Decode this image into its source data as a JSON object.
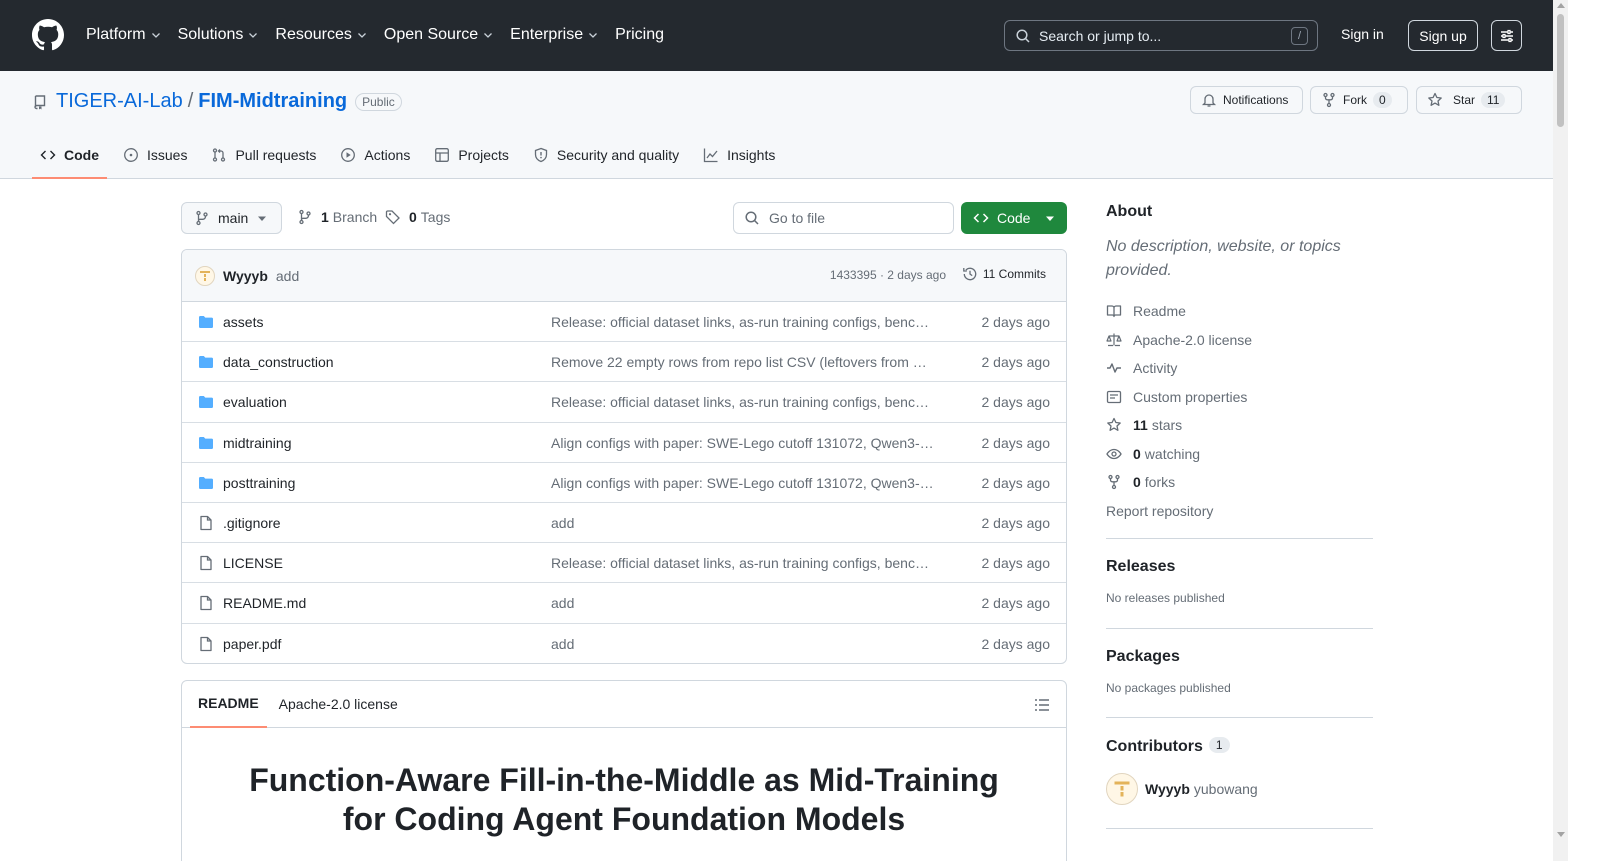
{
  "header": {
    "nav": [
      {
        "label": "Platform",
        "has_caret": true
      },
      {
        "label": "Solutions",
        "has_caret": true
      },
      {
        "label": "Resources",
        "has_caret": true
      },
      {
        "label": "Open Source",
        "has_caret": true
      },
      {
        "label": "Enterprise",
        "has_caret": true
      },
      {
        "label": "Pricing",
        "has_caret": false
      }
    ],
    "search_placeholder": "Search or jump to...",
    "search_shortcut": "/",
    "sign_in": "Sign in",
    "sign_up": "Sign up"
  },
  "repo": {
    "owner": "TIGER-AI-Lab",
    "separator": "/",
    "name": "FIM-Midtraining",
    "visibility": "Public",
    "notifications_label": "Notifications",
    "fork_label": "Fork",
    "fork_count": "0",
    "star_label": "Star",
    "star_count": "11"
  },
  "tabs": [
    {
      "label": "Code",
      "icon": "code-icon",
      "active": true
    },
    {
      "label": "Issues",
      "icon": "issue-icon",
      "active": false
    },
    {
      "label": "Pull requests",
      "icon": "pull-request-icon",
      "active": false
    },
    {
      "label": "Actions",
      "icon": "play-icon",
      "active": false
    },
    {
      "label": "Projects",
      "icon": "table-icon",
      "active": false
    },
    {
      "label": "Security and quality",
      "icon": "shield-icon",
      "active": false
    },
    {
      "label": "Insights",
      "icon": "graph-icon",
      "active": false
    }
  ],
  "toolbar": {
    "branch": "main",
    "branch_count": "1",
    "branch_label": "Branch",
    "tag_count": "0",
    "tag_label": "Tags",
    "go_to_file": "Go to file",
    "code_button": "Code"
  },
  "latest_commit": {
    "author": "Wyyyb",
    "message": "add",
    "hash_and_time": "1433395 · 2 days ago",
    "commits_label": "11 Commits"
  },
  "files": [
    {
      "name": "assets",
      "type": "folder",
      "message": "Release: official dataset links, as-run training configs, bench…",
      "date": "2 days ago"
    },
    {
      "name": "data_construction",
      "type": "folder",
      "message": "Remove 22 empty rows from repo list CSV (leftovers from m…",
      "date": "2 days ago"
    },
    {
      "name": "evaluation",
      "type": "folder",
      "message": "Release: official dataset links, as-run training configs, bench…",
      "date": "2 days ago"
    },
    {
      "name": "midtraining",
      "type": "folder",
      "message": "Align configs with paper: SWE-Lego cutoff 131072, Qwen3-…",
      "date": "2 days ago"
    },
    {
      "name": "posttraining",
      "type": "folder",
      "message": "Align configs with paper: SWE-Lego cutoff 131072, Qwen3-…",
      "date": "2 days ago"
    },
    {
      "name": ".gitignore",
      "type": "file",
      "message": "add",
      "date": "2 days ago"
    },
    {
      "name": "LICENSE",
      "type": "file",
      "message": "Release: official dataset links, as-run training configs, bench…",
      "date": "2 days ago"
    },
    {
      "name": "README.md",
      "type": "file",
      "message": "add",
      "date": "2 days ago"
    },
    {
      "name": "paper.pdf",
      "type": "file",
      "message": "add",
      "date": "2 days ago"
    }
  ],
  "readme": {
    "tab_readme": "README",
    "tab_license": "Apache-2.0 license",
    "title_line1": "Function-Aware Fill-in-the-Middle as Mid-Training",
    "title_line2": "for Coding Agent Foundation Models"
  },
  "sidebar": {
    "about_title": "About",
    "about_desc": "No description, website, or topics provided.",
    "items": [
      {
        "icon": "book-icon",
        "bold": "",
        "label": "Readme"
      },
      {
        "icon": "law-icon",
        "bold": "",
        "label": "Apache-2.0 license"
      },
      {
        "icon": "pulse-icon",
        "bold": "",
        "label": "Activity"
      },
      {
        "icon": "note-icon",
        "bold": "",
        "label": "Custom properties"
      },
      {
        "icon": "star-icon",
        "bold": "11",
        "label": "stars"
      },
      {
        "icon": "eye-icon",
        "bold": "0",
        "label": "watching"
      },
      {
        "icon": "fork-icon",
        "bold": "0",
        "label": "forks"
      }
    ],
    "report": "Report repository",
    "releases_title": "Releases",
    "releases_note": "No releases published",
    "packages_title": "Packages",
    "packages_note": "No packages published",
    "contributors_title": "Contributors",
    "contributors_count": "1",
    "contributor_name": "Wyyyb",
    "contributor_login": "yubowang"
  },
  "colors": {
    "header_bg": "#24292f",
    "link": "#0969da",
    "code_button": "#1f883d",
    "active_tab_underline": "#fd8c73",
    "folder": "#54aeff"
  }
}
